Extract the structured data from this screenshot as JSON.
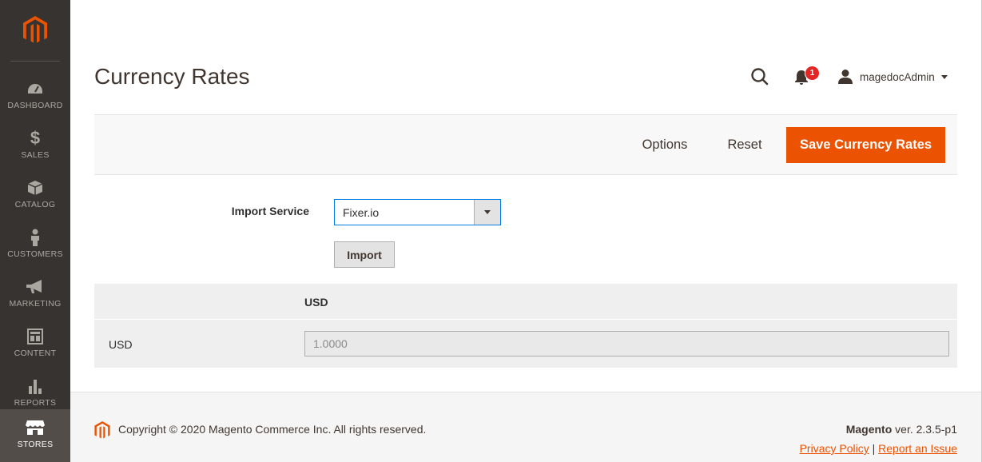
{
  "sidebar": {
    "logo_icon": "magento-logo-icon",
    "items": [
      {
        "label": "DASHBOARD",
        "icon": "dashboard-gauge-icon"
      },
      {
        "label": "SALES",
        "icon": "dollar-icon"
      },
      {
        "label": "CATALOG",
        "icon": "box-icon"
      },
      {
        "label": "CUSTOMERS",
        "icon": "person-icon"
      },
      {
        "label": "MARKETING",
        "icon": "megaphone-icon"
      },
      {
        "label": "CONTENT",
        "icon": "layout-icon"
      },
      {
        "label": "REPORTS",
        "icon": "bar-chart-icon"
      },
      {
        "label": "STORES",
        "icon": "store-icon",
        "active": true
      }
    ]
  },
  "header": {
    "title": "Currency Rates",
    "notification_count": "1",
    "user_name": "magedocAdmin"
  },
  "actions": {
    "options_label": "Options",
    "reset_label": "Reset",
    "save_label": "Save Currency Rates"
  },
  "form": {
    "import_service_label": "Import Service",
    "import_service_value": "Fixer.io",
    "import_button_label": "Import"
  },
  "rates": {
    "column_header": "USD",
    "rows": [
      {
        "currency": "USD",
        "value": "1.0000"
      }
    ]
  },
  "footer": {
    "copyright": "Copyright © 2020 Magento Commerce Inc. All rights reserved.",
    "brand": "Magento",
    "version": " ver. 2.3.5-p1",
    "privacy_link": "Privacy Policy",
    "separator": " | ",
    "report_link": "Report an Issue"
  },
  "colors": {
    "sidebar_bg": "#373330",
    "accent": "#eb5202",
    "badge": "#e22626",
    "select_border": "#007bdb"
  }
}
